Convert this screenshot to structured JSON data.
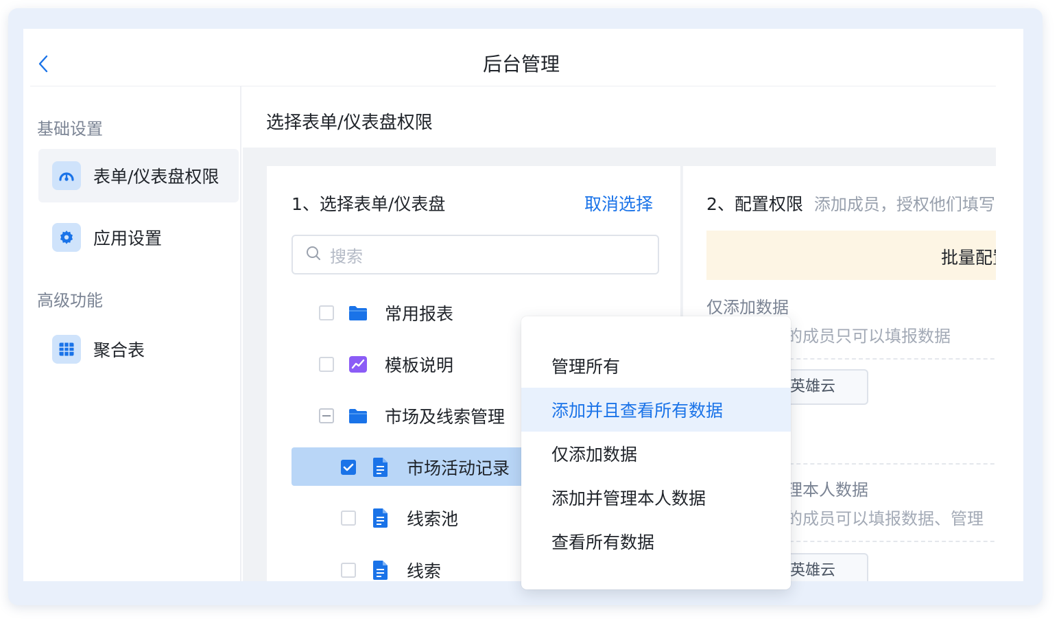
{
  "header": {
    "back_icon": "chevron-left-icon",
    "title": "后台管理"
  },
  "sidebar": {
    "group_basic": "基础设置",
    "group_advanced": "高级功能",
    "items": [
      {
        "label": "表单/仪表盘权限",
        "icon": "dashboard-gauge-icon",
        "active": true
      },
      {
        "label": "应用设置",
        "icon": "gear-icon",
        "active": false
      },
      {
        "label": "聚合表",
        "icon": "table-grid-icon",
        "active": false
      }
    ]
  },
  "main": {
    "title": "选择表单/仪表盘权限"
  },
  "select_panel": {
    "heading": "1、选择表单/仪表盘",
    "clear_link": "取消选择",
    "search_placeholder": "搜索",
    "tree": [
      {
        "label": "常用报表",
        "icon": "folder-icon",
        "state": "unchecked"
      },
      {
        "label": "模板说明",
        "icon": "dashboard-chart-icon",
        "state": "unchecked"
      },
      {
        "label": "市场及线索管理",
        "icon": "folder-icon",
        "state": "partial"
      },
      {
        "label": "市场活动记录",
        "icon": "form-document-icon",
        "state": "checked"
      },
      {
        "label": "线索池",
        "icon": "form-document-icon",
        "state": "unchecked"
      },
      {
        "label": "线索",
        "icon": "form-document-icon",
        "state": "unchecked"
      }
    ]
  },
  "config_panel": {
    "heading": "2、配置权限",
    "subheading": "添加成员，授权他们填写",
    "batch_label": "批量配置",
    "perm1_title": "仅添加数据",
    "perm1_desc": "的成员只可以填报数据",
    "perm1_tag": "英雄云",
    "perm2_title": "理本人数据",
    "perm2_desc": "的成员可以填报数据、管理",
    "perm2_tag": "英雄云"
  },
  "dropdown": {
    "items": [
      "管理所有",
      "添加并且查看所有数据",
      "仅添加数据",
      "添加并管理本人数据",
      "查看所有数据"
    ],
    "highlighted_index": 1
  },
  "colors": {
    "accent": "#1a73e8",
    "selected_row": "#b9d6f7",
    "hover_item": "#e8f1fd",
    "batch_bg": "#fdf5e4"
  }
}
